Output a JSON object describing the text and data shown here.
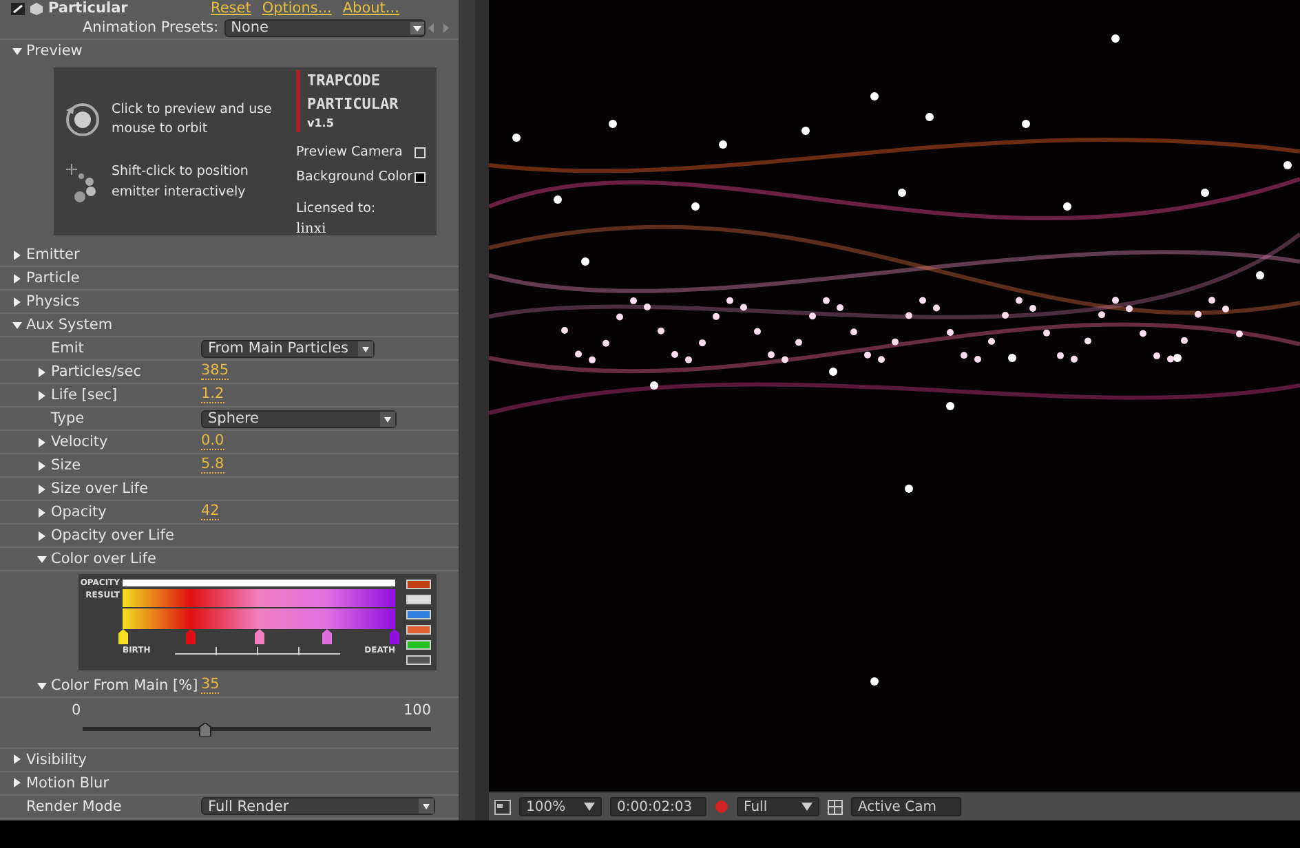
{
  "effect": {
    "name": "Particular",
    "links": [
      "Reset",
      "Options...",
      "About..."
    ],
    "presets_label": "Animation Presets:",
    "presets_value": "None"
  },
  "preview": {
    "title": "Preview",
    "expanded": true,
    "hints": [
      "Click to preview and use mouse to orbit",
      "Shift-click to position emitter interactively"
    ],
    "logo_lines": [
      "TRAPCODE",
      "PARTICULAR"
    ],
    "version": "v1.5",
    "options": [
      {
        "label": "Preview Camera",
        "checked": false
      },
      {
        "label": "Background Color",
        "checked": true
      }
    ],
    "license_label": "Licensed to:",
    "license_name": "linxi"
  },
  "rows": [
    {
      "kind": "group",
      "label": "Emitter",
      "expanded": false
    },
    {
      "kind": "group",
      "label": "Particle",
      "expanded": false
    },
    {
      "kind": "group",
      "label": "Physics",
      "expanded": false
    },
    {
      "kind": "group",
      "label": "Aux System",
      "expanded": true,
      "children": [
        {
          "kind": "dropdown",
          "label": "Emit",
          "value": "From Main Particles"
        },
        {
          "kind": "value",
          "label": "Particles/sec",
          "expanded": false,
          "value": "385"
        },
        {
          "kind": "value",
          "label": "Life [sec]",
          "expanded": false,
          "value": "1.2"
        },
        {
          "kind": "dropdown",
          "label": "Type",
          "value": "Sphere"
        },
        {
          "kind": "value",
          "label": "Velocity",
          "expanded": false,
          "value": "0.0"
        },
        {
          "kind": "value",
          "label": "Size",
          "expanded": false,
          "value": "5.8"
        },
        {
          "kind": "group",
          "label": "Size over Life",
          "expanded": false
        },
        {
          "kind": "value",
          "label": "Opacity",
          "expanded": false,
          "value": "42"
        },
        {
          "kind": "group",
          "label": "Opacity over Life",
          "expanded": false
        },
        {
          "kind": "gradient",
          "label": "Color over Life",
          "expanded": true,
          "opacity_label": "OPACITY",
          "result_label": "RESULT",
          "start_label": "BIRTH",
          "end_label": "DEATH",
          "stops": [
            {
              "color": "#f0e020"
            },
            {
              "color": "#e01010"
            },
            {
              "color": "#f080c0"
            },
            {
              "color": "#e070e0"
            },
            {
              "color": "#9010e0"
            }
          ]
        },
        {
          "kind": "slider",
          "label": "Color From Main [%]",
          "expanded": true,
          "value": "35",
          "min": "0",
          "max": "100",
          "level": 0.35
        }
      ]
    },
    {
      "kind": "group",
      "label": "Visibility",
      "expanded": false
    },
    {
      "kind": "group",
      "label": "Motion Blur",
      "expanded": false
    },
    {
      "kind": "dropdown",
      "label": "Render Mode",
      "value": "Full Render"
    }
  ],
  "viewer_toolbar": {
    "zoom": "100%",
    "timecode": "0:00:02:03",
    "resolution": "Full",
    "camera": "Active Cam"
  }
}
